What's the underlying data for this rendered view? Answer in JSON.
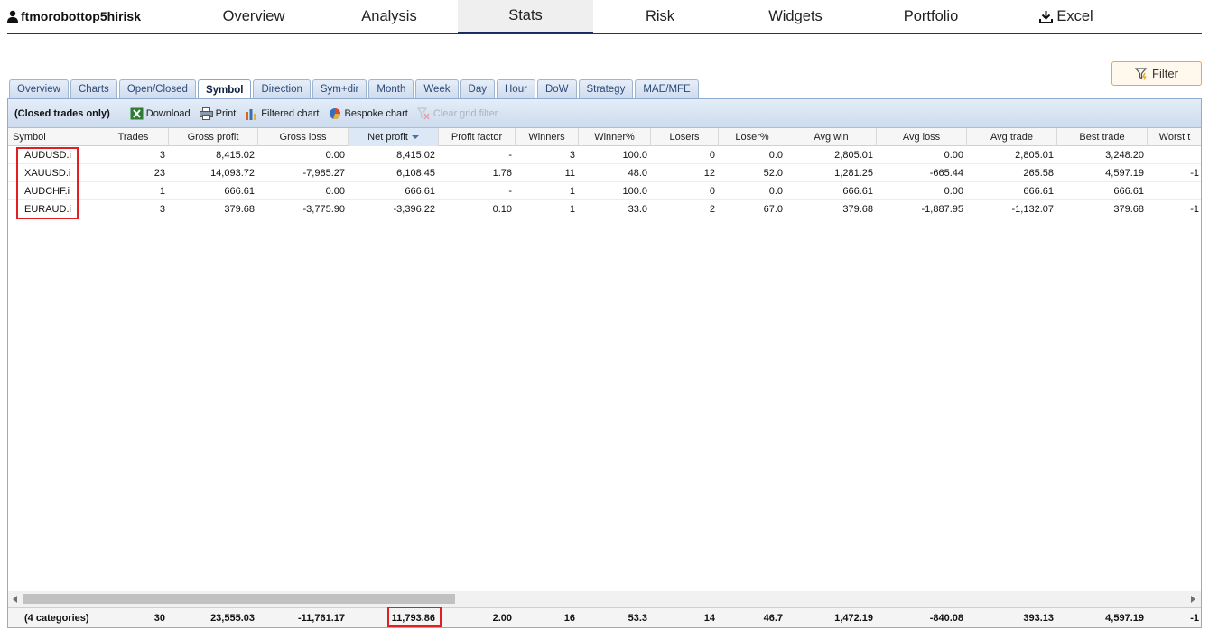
{
  "topnav": {
    "account": "ftmorobottop5hirisk",
    "tabs": [
      "Overview",
      "Analysis",
      "Stats",
      "Risk",
      "Widgets",
      "Portfolio",
      "Excel"
    ],
    "active_tab": "Stats"
  },
  "filter_label": "Filter",
  "subtabs": [
    "Overview",
    "Charts",
    "Open/Closed",
    "Symbol",
    "Direction",
    "Sym+dir",
    "Month",
    "Week",
    "Day",
    "Hour",
    "DoW",
    "Strategy",
    "MAE/MFE"
  ],
  "active_subtab": "Symbol",
  "toolbar": {
    "label": "(Closed trades only)",
    "download": "Download",
    "print": "Print",
    "filtered_chart": "Filtered chart",
    "bespoke_chart": "Bespoke chart",
    "clear_filter": "Clear grid filter"
  },
  "columns": [
    "Symbol",
    "Trades",
    "Gross profit",
    "Gross loss",
    "Net profit",
    "Profit factor",
    "Winners",
    "Winner%",
    "Losers",
    "Loser%",
    "Avg win",
    "Avg loss",
    "Avg trade",
    "Best trade",
    "Worst t"
  ],
  "sorted_column": "Net profit",
  "rows": [
    [
      "AUDUSD.i",
      "3",
      "8,415.02",
      "0.00",
      "8,415.02",
      "-",
      "3",
      "100.0",
      "0",
      "0.0",
      "2,805.01",
      "0.00",
      "2,805.01",
      "3,248.20",
      ""
    ],
    [
      "XAUUSD.i",
      "23",
      "14,093.72",
      "-7,985.27",
      "6,108.45",
      "1.76",
      "11",
      "48.0",
      "12",
      "52.0",
      "1,281.25",
      "-665.44",
      "265.58",
      "4,597.19",
      "-1"
    ],
    [
      "AUDCHF.i",
      "1",
      "666.61",
      "0.00",
      "666.61",
      "-",
      "1",
      "100.0",
      "0",
      "0.0",
      "666.61",
      "0.00",
      "666.61",
      "666.61",
      ""
    ],
    [
      "EURAUD.i",
      "3",
      "379.68",
      "-3,775.90",
      "-3,396.22",
      "0.10",
      "1",
      "33.0",
      "2",
      "67.0",
      "379.68",
      "-1,887.95",
      "-1,132.07",
      "379.68",
      "-1"
    ]
  ],
  "footer": [
    "(4 categories)",
    "30",
    "23,555.03",
    "-11,761.17",
    "11,793.86",
    "2.00",
    "16",
    "53.3",
    "14",
    "46.7",
    "1,472.19",
    "-840.08",
    "393.13",
    "4,597.19",
    "-1"
  ]
}
